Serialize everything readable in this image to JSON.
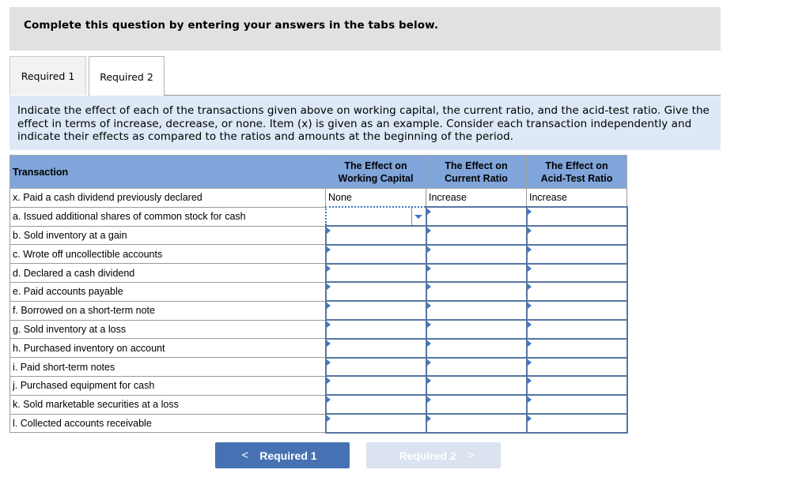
{
  "instructions": "Complete this question by entering your answers in the tabs below.",
  "tabs": [
    {
      "label": "Required 1",
      "active": false
    },
    {
      "label": "Required 2",
      "active": true
    }
  ],
  "question": "Indicate the effect of each of the transactions given above on working capital, the current ratio, and the acid-test ratio. Give the effect in terms of increase, decrease, or none. Item (x) is given as an example. Consider each transaction independently and indicate their effects as compared to the ratios and amounts at the beginning of the period.",
  "table": {
    "headers": {
      "transaction": "Transaction",
      "working_capital_line1": "The Effect on",
      "working_capital_line2": "Working Capital",
      "current_ratio_line1": "The Effect on",
      "current_ratio_line2": "Current Ratio",
      "acid_test_line1": "The Effect on",
      "acid_test_line2": "Acid-Test Ratio"
    },
    "example": {
      "label": "x. Paid a cash dividend previously declared",
      "working_capital": "None",
      "current_ratio": "Increase",
      "acid_test": "Increase"
    },
    "rows": [
      {
        "label": "a. Issued additional shares of common stock for cash",
        "working_capital": "",
        "current_ratio": "",
        "acid_test": ""
      },
      {
        "label": "b. Sold inventory at a gain",
        "working_capital": "",
        "current_ratio": "",
        "acid_test": ""
      },
      {
        "label": "c. Wrote off uncollectible accounts",
        "working_capital": "",
        "current_ratio": "",
        "acid_test": ""
      },
      {
        "label": "d. Declared a cash dividend",
        "working_capital": "",
        "current_ratio": "",
        "acid_test": ""
      },
      {
        "label": "e. Paid accounts payable",
        "working_capital": "",
        "current_ratio": "",
        "acid_test": ""
      },
      {
        "label": "f. Borrowed on a short-term note",
        "working_capital": "",
        "current_ratio": "",
        "acid_test": ""
      },
      {
        "label": "g. Sold inventory at a loss",
        "working_capital": "",
        "current_ratio": "",
        "acid_test": ""
      },
      {
        "label": "h. Purchased inventory on account",
        "working_capital": "",
        "current_ratio": "",
        "acid_test": ""
      },
      {
        "label": "i. Paid short-term notes",
        "working_capital": "",
        "current_ratio": "",
        "acid_test": ""
      },
      {
        "label": "j. Purchased equipment for cash",
        "working_capital": "",
        "current_ratio": "",
        "acid_test": ""
      },
      {
        "label": "k. Sold marketable securities at a loss",
        "working_capital": "",
        "current_ratio": "",
        "acid_test": ""
      },
      {
        "label": "l. Collected accounts receivable",
        "working_capital": "",
        "current_ratio": "",
        "acid_test": ""
      }
    ]
  },
  "nav": {
    "prev_label": "Required 1",
    "prev_icon": "chevron-left-icon",
    "prev_glyph": "<",
    "next_label": "Required 2",
    "next_icon": "chevron-right-icon",
    "next_glyph": ">",
    "next_disabled": true
  },
  "colors": {
    "header_bg": "#7fa5da",
    "question_bg": "#dde9f7",
    "input_border": "#5676a1",
    "prev_button": "#4672b3",
    "next_button_disabled": "#dae3ef"
  }
}
